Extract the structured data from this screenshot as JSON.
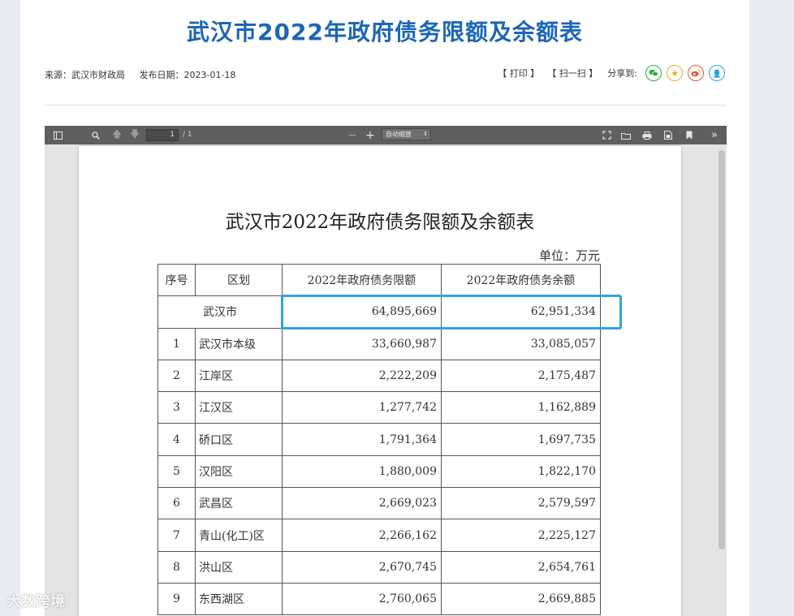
{
  "header": {
    "title": "武汉市2022年政府债务限额及余额表",
    "source": "来源：武汉市财政局",
    "date": "发布日期：2023-01-18",
    "print": "【 打印 】",
    "scan": "【 扫一扫 】",
    "share": "分享到:"
  },
  "share_icons": [
    "wechat-icon",
    "qzone-star-icon",
    "weibo-icon",
    "qq-icon"
  ],
  "colors": {
    "title": "#1d66b7",
    "highlight": "#2ea3e3",
    "toolbar": "#5f5f5f"
  },
  "viewer": {
    "page_value": "1",
    "page_count": "/ 1",
    "zoom_out": "—",
    "zoom_in": "+",
    "zoom": "自动缩放"
  },
  "document": {
    "title": "武汉市2022年政府债务限额及余额表",
    "unit": "单位：万元",
    "headers": [
      "序号",
      "区划",
      "2022年政府债务限额",
      "2022年政府债务余额"
    ],
    "total": {
      "label": "武汉市",
      "limit": "64,895,669",
      "balance": "62,951,334"
    },
    "rows": [
      {
        "no": "1",
        "region": "武汉市本级",
        "limit": "33,660,987",
        "balance": "33,085,057"
      },
      {
        "no": "2",
        "region": "江岸区",
        "limit": "2,222,209",
        "balance": "2,175,487"
      },
      {
        "no": "3",
        "region": "江汉区",
        "limit": "1,277,742",
        "balance": "1,162,889"
      },
      {
        "no": "4",
        "region": "硚口区",
        "limit": "1,791,364",
        "balance": "1,697,735"
      },
      {
        "no": "5",
        "region": "汉阳区",
        "limit": "1,880,009",
        "balance": "1,822,170"
      },
      {
        "no": "6",
        "region": "武昌区",
        "limit": "2,669,023",
        "balance": "2,579,597"
      },
      {
        "no": "7",
        "region": "青山(化工)区",
        "limit": "2,266,162",
        "balance": "2,225,127"
      },
      {
        "no": "8",
        "region": "洪山区",
        "limit": "2,670,745",
        "balance": "2,654,761"
      },
      {
        "no": "9",
        "region": "东西湖区",
        "limit": "2,760,065",
        "balance": "2,669,885"
      }
    ]
  },
  "watermark": "大数跨境"
}
